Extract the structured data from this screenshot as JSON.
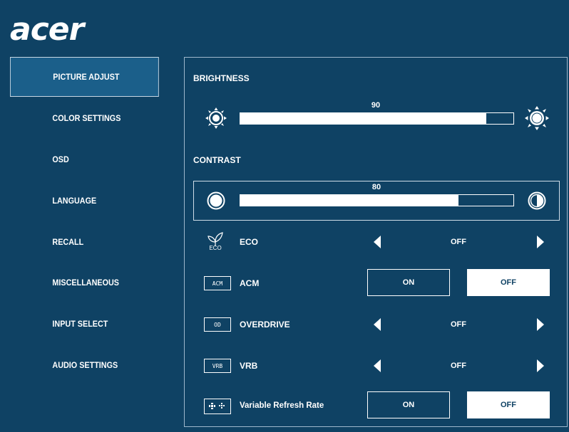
{
  "brand": {
    "logo_text": "acer"
  },
  "nav": {
    "items": [
      {
        "label": "PICTURE ADJUST",
        "active": true
      },
      {
        "label": "COLOR SETTINGS"
      },
      {
        "label": "OSD"
      },
      {
        "label": "LANGUAGE"
      },
      {
        "label": "RECALL"
      },
      {
        "label": "MISCELLANEOUS"
      },
      {
        "label": "INPUT SELECT"
      },
      {
        "label": "AUDIO SETTINGS"
      }
    ]
  },
  "panel": {
    "brightness": {
      "label": "BRIGHTNESS",
      "value": "90",
      "level": 0.9
    },
    "contrast": {
      "label": "CONTRAST",
      "value": "80",
      "level": 0.8
    },
    "eco": {
      "icon_caption": "ECO",
      "label": "ECO",
      "value": "OFF"
    },
    "acm": {
      "tag": "ACM",
      "label": "ACM",
      "on_label": "ON",
      "off_label": "OFF",
      "selected": "OFF"
    },
    "overdrive": {
      "tag": "OD",
      "label": "OVERDRIVE",
      "value": "OFF"
    },
    "vrb": {
      "tag": "VRB",
      "label": "VRB",
      "value": "OFF"
    },
    "vrr": {
      "label": "Variable Refresh Rate",
      "on_label": "ON",
      "off_label": "OFF",
      "selected": "OFF"
    }
  },
  "colors": {
    "background": "#0f4264",
    "active_nav": "#1b5f8a",
    "highlight": "#ffffff"
  }
}
